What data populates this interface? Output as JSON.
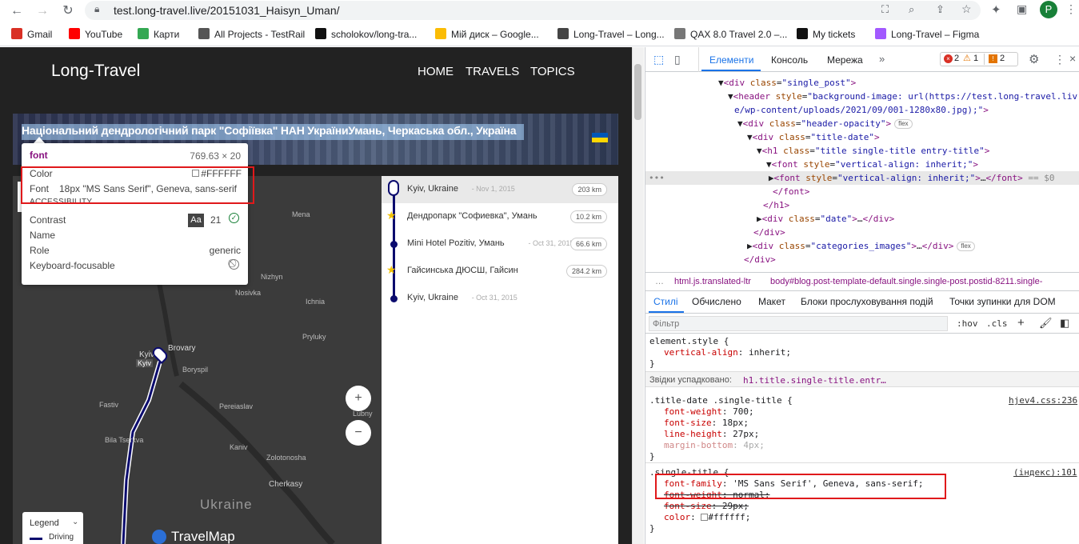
{
  "browser": {
    "url": "test.long-travel.live/20151031_Haisyn_Uman/",
    "bookmarks": [
      {
        "label": "Gmail",
        "color": "#d93025"
      },
      {
        "label": "YouTube",
        "color": "#ff0000"
      },
      {
        "label": "Карти",
        "color": "#34a853"
      },
      {
        "label": "All Projects - TestRail",
        "color": "#555"
      },
      {
        "label": "scholokov/long-tra...",
        "color": "#111"
      },
      {
        "label": "Мій диск – Google...",
        "color": "#fbbc04"
      },
      {
        "label": "Long-Travel – Long...",
        "color": "#444"
      },
      {
        "label": "QAX 8.0 Travel 2.0 –...",
        "color": "#777"
      },
      {
        "label": "My tickets",
        "color": "#111"
      },
      {
        "label": "Long-Travel – Figma",
        "color": "#a259ff"
      }
    ],
    "profile_initial": "P"
  },
  "site": {
    "logo": "Long-Travel",
    "nav": [
      "HOME",
      "TRAVELS",
      "TOPICS"
    ],
    "post_title": "Національний дендрологічний парк \"Софіївка\" НАН УкраїниУмань, Черкаська обл., Україна"
  },
  "tooltip": {
    "tag": "font",
    "size": "769.63 × 20",
    "color_label": "Color",
    "color_value": "#FFFFFF",
    "font_label": "Font",
    "font_value": "18px \"MS Sans Serif\", Geneva, sans-serif",
    "accessibility_header": "ACCESSIBILITY",
    "rows": [
      {
        "label": "Contrast",
        "value": "21"
      },
      {
        "label": "Name",
        "value": ""
      },
      {
        "label": "Role",
        "value": "generic"
      },
      {
        "label": "Keyboard-focusable",
        "value": ""
      }
    ],
    "contrast_badge": "Aa"
  },
  "map": {
    "labels": [
      "Mena",
      "Nizhyn",
      "Nosivka",
      "Ichnia",
      "Pryluky",
      "Brovary",
      "Boryspil",
      "Fastiv",
      "Pereiaslav",
      "Lubny",
      "Bila Tserkva",
      "Kaniv",
      "Zolotonosha",
      "Cherkasy",
      "Ukraine",
      "Kyiv",
      "Kyiv"
    ],
    "zoom_in": "+",
    "zoom_out": "−",
    "legend_title": "Legend",
    "legend_item": "Driving",
    "brand": "TravelMap"
  },
  "itinerary": [
    {
      "place": "Kyiv, Ukraine",
      "date": "- Nov 1, 2015",
      "distance": "203 km"
    },
    {
      "place": "Дендропарк \"Софиевка\", Умань",
      "date": "",
      "distance": "10.2 km"
    },
    {
      "place": "Mini Hotel Pozitiv, Умань",
      "date": "- Oct 31, 2015",
      "distance": "66.6 km"
    },
    {
      "place": "Гайсинська ДЮСШ, Гайсин",
      "date": "",
      "distance": "284.2 km"
    },
    {
      "place": "Kyiv, Ukraine",
      "date": "- Oct 31, 2015",
      "distance": ""
    }
  ],
  "devtools": {
    "tabs": [
      "Елементи",
      "Консоль",
      "Мережа"
    ],
    "errors": "2",
    "warnings": "1",
    "issues": "2",
    "breadcrumb_left": "html.js.translated-ltr",
    "breadcrumb_right": "body#blog.post-template-default.single.single-post.postid-8211.single-",
    "style_tabs": [
      "Стилі",
      "Обчислено",
      "Макет",
      "Блоки прослуховування подій",
      "Точки зупинки для DOM"
    ],
    "filter_placeholder": "Фільтр",
    "hov": ":hov",
    "cls": ".cls",
    "inherited_label": "Звідки успадковано:",
    "inherited_selector": "h1.title.single-title.entr…",
    "file1": "hjev4.css:236",
    "file2": "(індекс):101",
    "dom_dollar": "== $0",
    "flex": "flex"
  },
  "colors": {
    "accent": "#1a73e8",
    "route": "#0b0b6e",
    "highlight": "#e0191b"
  }
}
